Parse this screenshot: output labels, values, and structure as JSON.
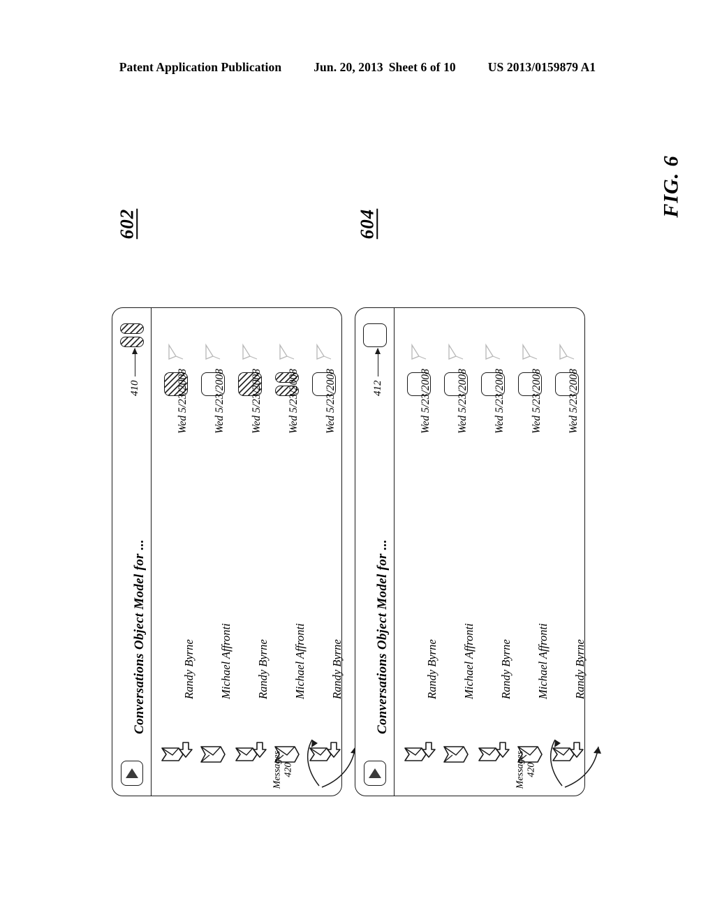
{
  "page_header": {
    "publication": "Patent Application Publication",
    "date": "Jun. 20, 2013",
    "sheet": "Sheet 6 of 10",
    "patent_number": "US 2013/0159879 A1"
  },
  "figure": {
    "caption": "FIG. 6",
    "panel_refs": [
      "602",
      "604"
    ]
  },
  "panels": [
    {
      "ref": "602",
      "header": {
        "title": "Conversations Object Model for ...",
        "ref_number": "410",
        "expander_icon": "play-triangle-icon",
        "checkbox_state": "partial"
      },
      "callout": {
        "label": "Messages",
        "ref_number": "420"
      },
      "rows": [
        {
          "sender": "Randy Byrne",
          "date": "Wed 5/23/2008",
          "checkbox_state": "checked",
          "envelope_icon": "envelope-down-arrow-icon",
          "flag_icon": "flag-icon"
        },
        {
          "sender": "Michael Affronti",
          "date": "Wed 5/23/2008",
          "checkbox_state": "unchecked",
          "envelope_icon": "envelope-icon",
          "flag_icon": "flag-icon"
        },
        {
          "sender": "Randy Byrne",
          "date": "Wed 5/23/2008",
          "checkbox_state": "checked",
          "envelope_icon": "envelope-down-arrow-icon",
          "flag_icon": "flag-icon"
        },
        {
          "sender": "Michael Affronti",
          "date": "Wed 5/23/2008",
          "checkbox_state": "partial",
          "envelope_icon": "envelope-icon",
          "flag_icon": "flag-icon"
        },
        {
          "sender": "Randy Byrne",
          "date": "Wed 5/23/2008",
          "checkbox_state": "unchecked",
          "envelope_icon": "envelope-down-arrow-icon",
          "flag_icon": "flag-icon"
        }
      ]
    },
    {
      "ref": "604",
      "header": {
        "title": "Conversations Object Model for ...",
        "ref_number": "412",
        "expander_icon": "play-triangle-icon",
        "checkbox_state": "unchecked"
      },
      "callout": {
        "label": "Messages",
        "ref_number": "420"
      },
      "rows": [
        {
          "sender": "Randy Byrne",
          "date": "Wed 5/23/2008",
          "checkbox_state": "unchecked",
          "envelope_icon": "envelope-down-arrow-icon",
          "flag_icon": "flag-icon"
        },
        {
          "sender": "Michael Affronti",
          "date": "Wed 5/23/2008",
          "checkbox_state": "unchecked",
          "envelope_icon": "envelope-icon",
          "flag_icon": "flag-icon"
        },
        {
          "sender": "Randy Byrne",
          "date": "Wed 5/23/2008",
          "checkbox_state": "unchecked",
          "envelope_icon": "envelope-down-arrow-icon",
          "flag_icon": "flag-icon"
        },
        {
          "sender": "Michael Affronti",
          "date": "Wed 5/23/2008",
          "checkbox_state": "unchecked",
          "envelope_icon": "envelope-icon",
          "flag_icon": "flag-icon"
        },
        {
          "sender": "Randy Byrne",
          "date": "Wed 5/23/2008",
          "checkbox_state": "unchecked",
          "envelope_icon": "envelope-down-arrow-icon",
          "flag_icon": "flag-icon"
        }
      ]
    }
  ]
}
